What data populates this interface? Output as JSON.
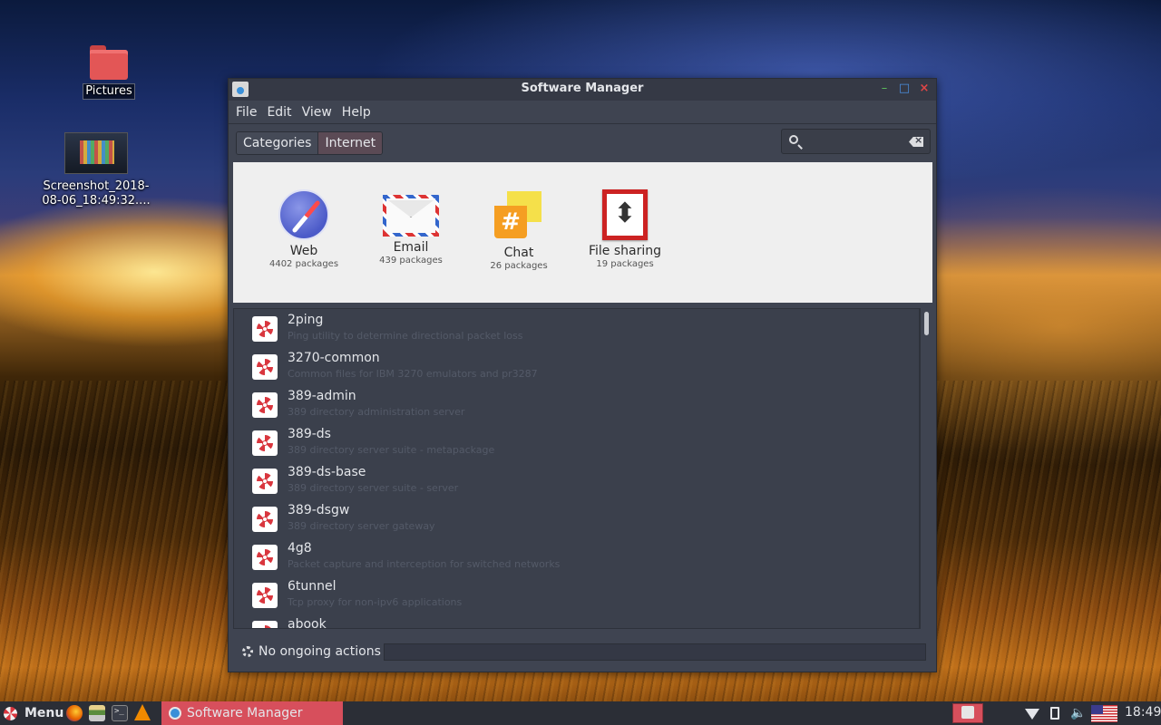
{
  "desktop": {
    "icons": [
      {
        "label": "Pictures"
      },
      {
        "label_line1": "Screenshot_2018-",
        "label_line2": "08-06_18:49:32...."
      }
    ]
  },
  "window": {
    "title": "Software Manager",
    "menu": [
      "File",
      "Edit",
      "View",
      "Help"
    ],
    "breadcrumb": [
      "Categories",
      "Internet"
    ],
    "search": {
      "value": "",
      "placeholder": ""
    },
    "categories": [
      {
        "name": "Web",
        "count": "4402 packages",
        "icon": "compass-icon"
      },
      {
        "name": "Email",
        "count": "439 packages",
        "icon": "envelope-icon"
      },
      {
        "name": "Chat",
        "count": "26 packages",
        "icon": "chat-icon"
      },
      {
        "name": "File sharing",
        "count": "19 packages",
        "icon": "file-sharing-icon"
      }
    ],
    "packages": [
      {
        "name": "2ping",
        "desc": "Ping utility to determine directional packet loss"
      },
      {
        "name": "3270-common",
        "desc": "Common files for IBM 3270 emulators and pr3287"
      },
      {
        "name": "389-admin",
        "desc": "389 directory administration server"
      },
      {
        "name": "389-ds",
        "desc": "389 directory server suite - metapackage"
      },
      {
        "name": "389-ds-base",
        "desc": "389 directory server suite - server"
      },
      {
        "name": "389-dsgw",
        "desc": "389 directory server gateway"
      },
      {
        "name": "4g8",
        "desc": "Packet capture and interception for switched networks"
      },
      {
        "name": "6tunnel",
        "desc": "Tcp proxy for non-ipv6 applications"
      },
      {
        "name": "abook",
        "desc": ""
      }
    ],
    "status": "No ongoing actions"
  },
  "taskbar": {
    "menu_label": "Menu",
    "window_button": "Software Manager",
    "clock": "18:49"
  },
  "colors": {
    "accent": "#d74f5c",
    "window_bg": "#3f4451",
    "category_panel_bg": "#efefef"
  }
}
